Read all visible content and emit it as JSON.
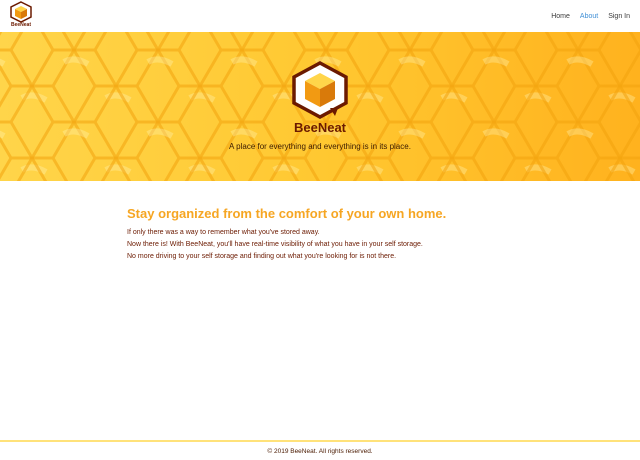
{
  "navbar": {
    "brand_label": "BeeNeat",
    "links": [
      {
        "label": "Home",
        "active": false
      },
      {
        "label": "About",
        "active": true
      },
      {
        "label": "Sign In",
        "active": false
      }
    ]
  },
  "hero": {
    "title": "BeeNeat",
    "tagline": "A place for everything and everything is in its place."
  },
  "content": {
    "heading": "Stay organized from the comfort of your own home.",
    "lines": [
      "If only there was a way to remember what you've stored away.",
      "Now there is! With BeeNeat, you'll have real-time visibility of what you have in your self storage.",
      "No more driving to your self storage and finding out what you're looking for is not there."
    ]
  },
  "footer": {
    "text": "© 2019 BeeNeat. All rights reserved."
  },
  "colors": {
    "brand_dark": "#6b1a00",
    "accent_orange": "#f6a623",
    "honey_yellow": "#ffc831",
    "link_active": "#3f8fd6"
  },
  "icons": {
    "brand_logo": "beeneat-cube-logo-icon",
    "hero_logo": "beeneat-cube-logo-icon"
  }
}
